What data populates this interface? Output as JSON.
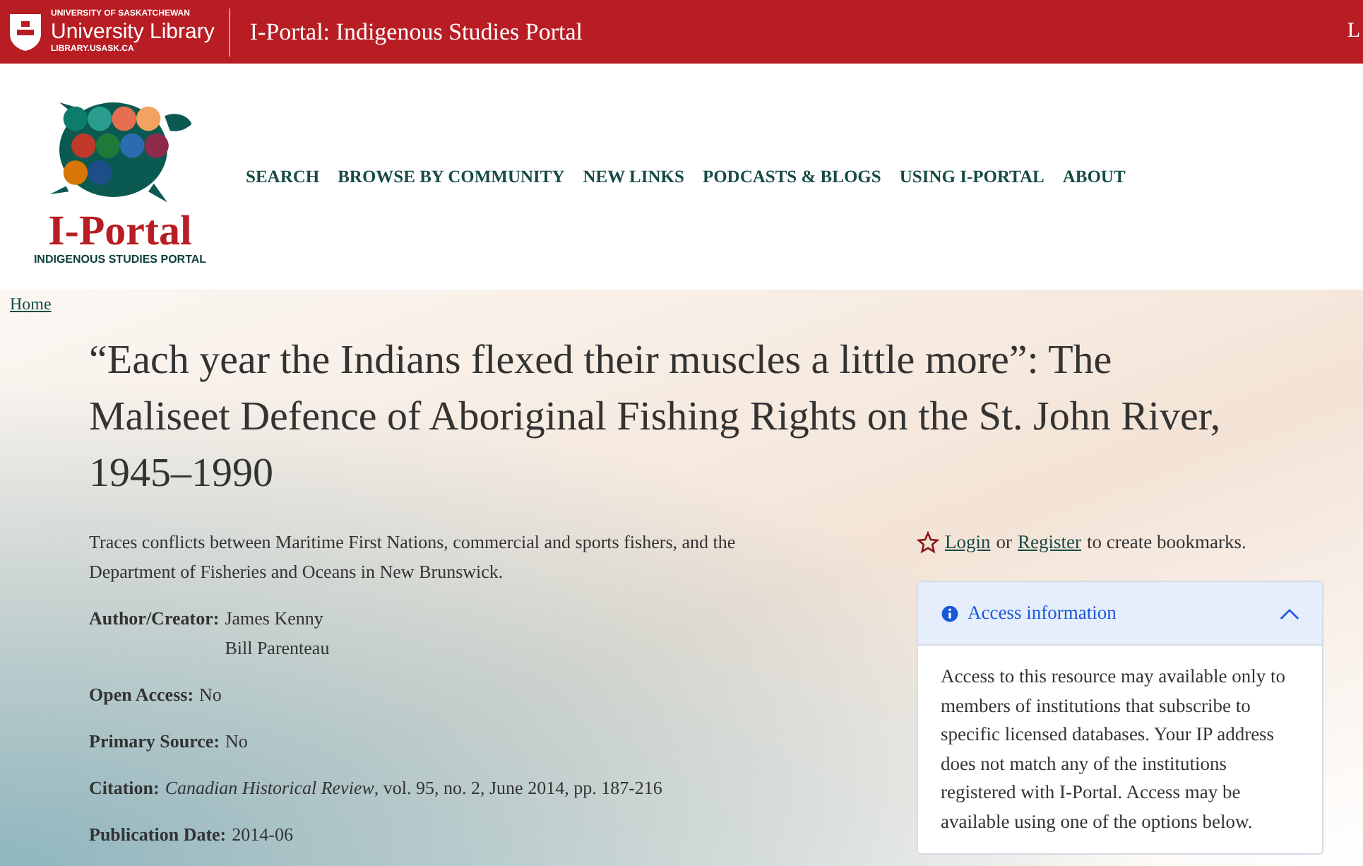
{
  "header": {
    "university": "UNIVERSITY OF SASKATCHEWAN",
    "library": "University Library",
    "url": "LIBRARY.USASK.CA",
    "portal_title": "I-Portal: Indigenous Studies Portal",
    "cut_link": "L"
  },
  "logo": {
    "name": "I-Portal",
    "tagline": "INDIGENOUS STUDIES PORTAL"
  },
  "nav": [
    "SEARCH",
    "BROWSE BY COMMUNITY",
    "NEW LINKS",
    "PODCASTS & BLOGS",
    "USING I-PORTAL",
    "ABOUT"
  ],
  "breadcrumb": [
    "Home"
  ],
  "title": "“Each year the Indians flexed their muscles a little more”: The Maliseet Defence of Aboriginal Fishing Rights on the St. John River, 1945–1990",
  "description": "Traces conflicts between Maritime First Nations, commercial and sports fishers, and the Department of Fisheries and Oceans in New Brunswick.",
  "fields": [
    {
      "label": "Author/Creator:",
      "values": [
        "James Kenny",
        "Bill Parenteau"
      ]
    },
    {
      "label": "Open Access:",
      "values": [
        "No"
      ]
    },
    {
      "label": "Primary Source:",
      "values": [
        "No"
      ]
    },
    {
      "label": "Citation:",
      "values": [
        "*Canadian Historical Review*, vol. 95, no. 2, June 2014, pp. 187-216"
      ]
    },
    {
      "label": "Publication Date:",
      "values": [
        "2014-06"
      ]
    }
  ],
  "bookmark": {
    "login": "Login",
    "or": "or",
    "register": "Register",
    "rest": "to create bookmarks."
  },
  "access": {
    "title": "Access information",
    "expanded": true,
    "body": "Access to this resource may available only to members of institutions that subscribe to specific licensed databases. Your IP address does not match any of the institutions registered with I-Portal. Access may be available using one of the options below."
  }
}
